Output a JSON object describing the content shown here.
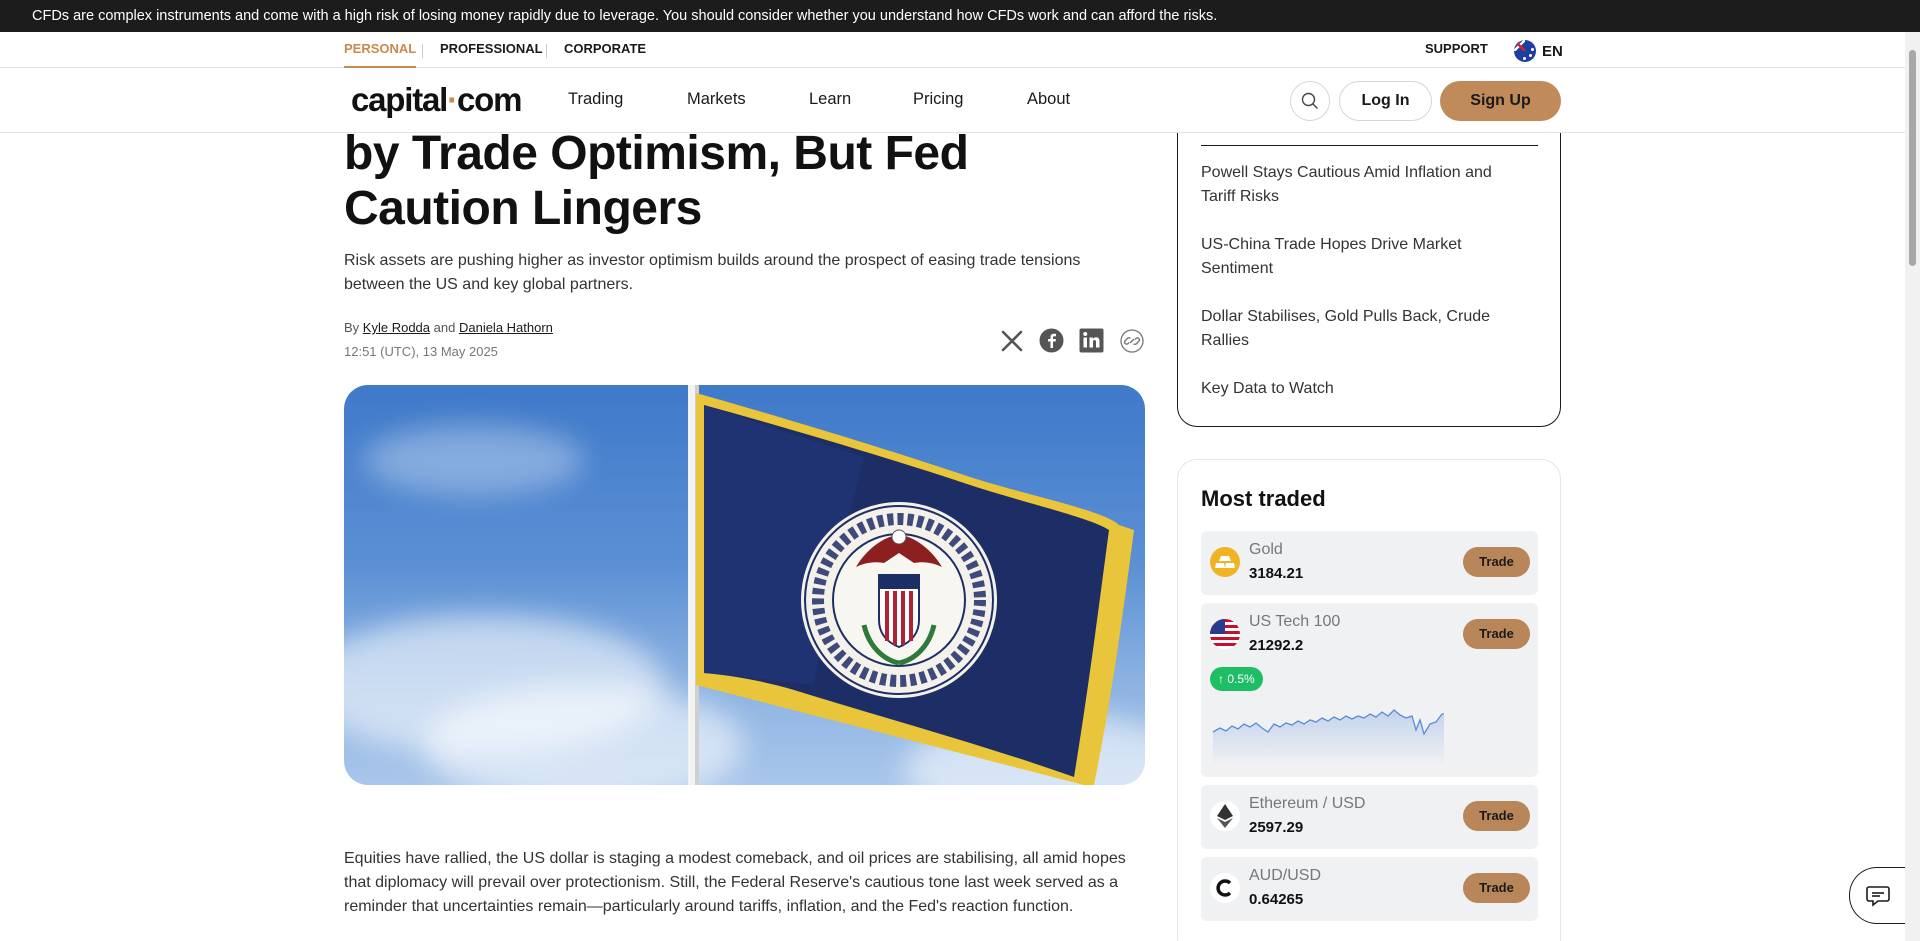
{
  "risk_banner": "CFDs are complex instruments and come with a high risk of losing money rapidly due to leverage. You should consider whether you understand how CFDs work and can afford the risks.",
  "segments": [
    {
      "label": "PERSONAL"
    },
    {
      "label": "PROFESSIONAL"
    },
    {
      "label": "CORPORATE"
    }
  ],
  "support_label": "SUPPORT",
  "language": "EN",
  "logo": {
    "part1": "capital",
    "part2": "com"
  },
  "nav": [
    {
      "label": "Trading"
    },
    {
      "label": "Markets"
    },
    {
      "label": "Learn"
    },
    {
      "label": "Pricing"
    },
    {
      "label": "About"
    }
  ],
  "login_label": "Log In",
  "signup_label": "Sign Up",
  "article": {
    "title_line1": "by Trade Optimism, But Fed",
    "title_line2": "Caution Lingers",
    "subtitle": "Risk assets are pushing higher as investor optimism builds around the prospect of easing trade tensions between the US and key global partners.",
    "by": "By",
    "and": "and",
    "author1": "Kyle Rodda",
    "author2": "Daniela Hathorn",
    "date": "12:51 (UTC), 13 May 2025",
    "body": "Equities have rallied, the US dollar is staging a modest comeback, and oil prices are stabilising, all amid hopes that diplomacy will prevail over protectionism. Still, the Federal Reserve's cautious tone last week served as a reminder that uncertainties remain—particularly around tariffs, inflation, and the Fed's reaction function."
  },
  "toc": [
    {
      "label": "Powell Stays Cautious Amid Inflation and Tariff Risks"
    },
    {
      "label": "US-China Trade Hopes Drive Market Sentiment"
    },
    {
      "label": "Dollar Stabilises, Gold Pulls Back, Crude Rallies"
    },
    {
      "label": "Key Data to Watch"
    }
  ],
  "most_traded": {
    "title": "Most traded",
    "trade_label": "Trade",
    "instruments": [
      {
        "name": "Gold",
        "price": "3184.21",
        "icon": "gold-icon"
      },
      {
        "name": "US Tech 100",
        "price": "21292.2",
        "icon": "us-flag-icon",
        "change": "↑ 0.5%"
      },
      {
        "name": "Ethereum / USD",
        "price": "2597.29",
        "icon": "ethereum-icon"
      },
      {
        "name": "AUD/USD",
        "price": "0.64265",
        "icon": "capital-c-icon"
      }
    ]
  },
  "colors": {
    "accent": "#c98a4b",
    "trade_button": "#b88658",
    "positive": "#1ebe67"
  }
}
